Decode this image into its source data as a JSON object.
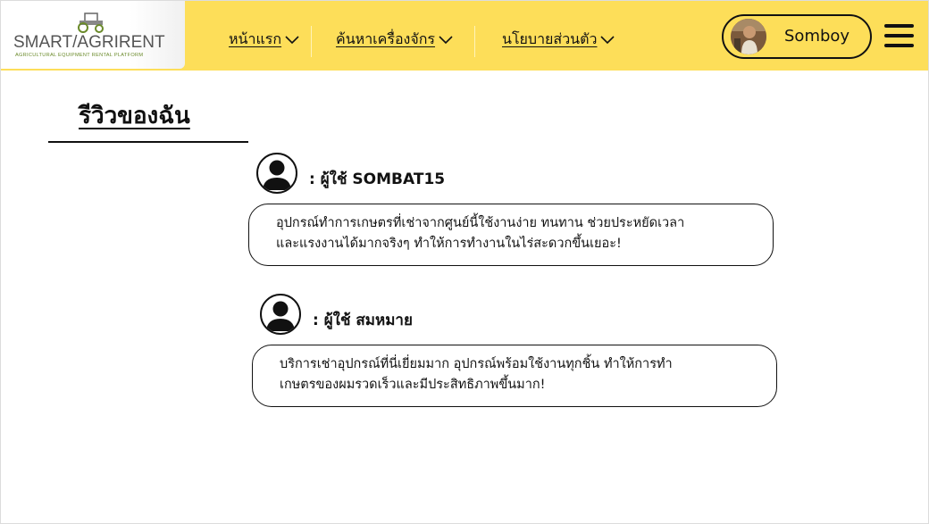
{
  "logo": {
    "title": "SMART/AGRIRENT",
    "subtitle": "AGRICULTURAL EQUIPMENT RENTAL PLATFORM",
    "icon": "tractor-icon"
  },
  "nav": {
    "items": [
      {
        "label": "หน้าแรก",
        "icon": "chevron-down-icon"
      },
      {
        "label": "ค้นหาเครื่องจักร",
        "icon": "chevron-down-icon"
      },
      {
        "label": "นโยบายส่วนตัว",
        "icon": "chevron-down-icon"
      }
    ]
  },
  "user": {
    "name": "Somboy",
    "avatar_icon": "user-photo"
  },
  "menu_icon": "hamburger-icon",
  "page": {
    "title": "รีวิวของฉัน"
  },
  "reviews": [
    {
      "user_label": ": ผู้ใช้ SOMBAT15",
      "lines": [
        "อุปกรณ์ทำการเกษตรที่เช่าจากศูนย์นี้ใช้งานง่าย ทนทาน ช่วยประหยัดเวลา",
        "และแรงงานได้มากจริงๆ ทำให้การทำงานในไร่สะดวกขึ้นเยอะ!"
      ]
    },
    {
      "user_label": ": ผู้ใช้ สมหมาย",
      "lines": [
        "บริการเช่าอุปกรณ์ที่นี่เยี่ยมมาก อุปกรณ์พร้อมใช้งานทุกชิ้น ทำให้การทำ",
        "เกษตรของผมรวดเร็วและมีประสิทธิภาพขึ้นมาก!"
      ]
    }
  ],
  "colors": {
    "header_bg": "#fdde59",
    "text": "#111111",
    "logo_green": "#6a8a2a"
  }
}
